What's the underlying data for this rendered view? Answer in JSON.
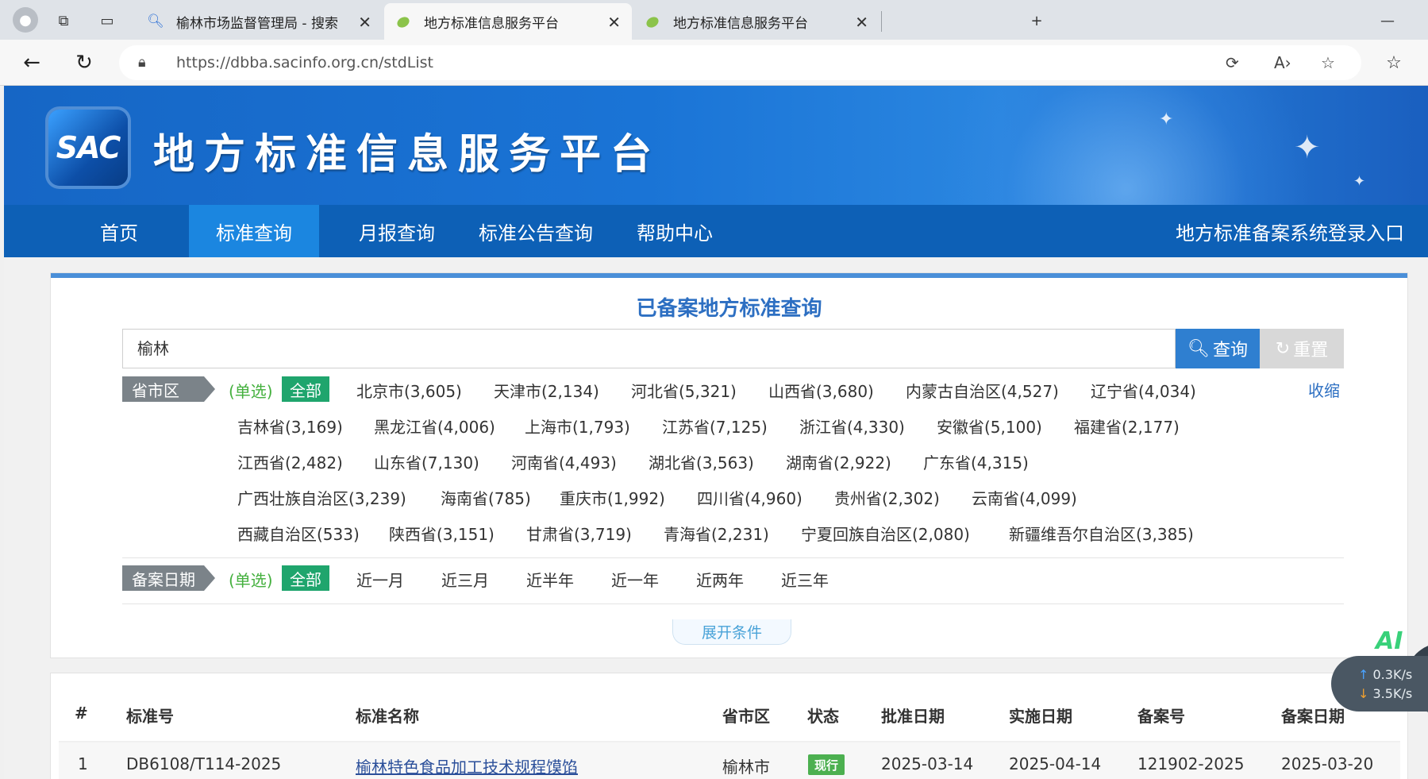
{
  "browser": {
    "tabs": [
      {
        "title": "榆林市场监督管理局 - 搜索",
        "favicon": "search-icon",
        "active": false
      },
      {
        "title": "地方标准信息服务平台",
        "favicon": "leaf-icon",
        "active": true
      },
      {
        "title": "地方标准信息服务平台",
        "favicon": "leaf-icon",
        "active": false
      }
    ],
    "new_tab_symbol": "+",
    "minimize_symbol": "—",
    "url": "https://dbba.sacinfo.org.cn/stdList"
  },
  "site": {
    "logo_text": "SAC",
    "title": "地方标准信息服务平台"
  },
  "nav": {
    "items": [
      {
        "label": "首页",
        "active": false
      },
      {
        "label": "标准查询",
        "active": true
      },
      {
        "label": "月报查询",
        "active": false
      },
      {
        "label": "标准公告查询",
        "active": false
      },
      {
        "label": "帮助中心",
        "active": false
      }
    ],
    "login_label": "地方标准备案系统登录入口"
  },
  "search": {
    "heading": "已备案地方标准查询",
    "query_value": "榆林",
    "query_button": "查询",
    "reset_button": "重置",
    "province_filter": {
      "label": "省市区",
      "mode_hint": "(单选)",
      "all_label": "全部",
      "collapse_label": "收缩",
      "options": [
        "北京市(3,605)",
        "天津市(2,134)",
        "河北省(5,321)",
        "山西省(3,680)",
        "内蒙古自治区(4,527)",
        "辽宁省(4,034)",
        "吉林省(3,169)",
        "黑龙江省(4,006)",
        "上海市(1,793)",
        "江苏省(7,125)",
        "浙江省(4,330)",
        "安徽省(5,100)",
        "福建省(2,177)",
        "江西省(2,482)",
        "山东省(7,130)",
        "河南省(4,493)",
        "湖北省(3,563)",
        "湖南省(2,922)",
        "广东省(4,315)",
        "广西壮族自治区(3,239)",
        "海南省(785)",
        "重庆市(1,992)",
        "四川省(4,960)",
        "贵州省(2,302)",
        "云南省(4,099)",
        "西藏自治区(533)",
        "陕西省(3,151)",
        "甘肃省(3,719)",
        "青海省(2,231)",
        "宁夏回族自治区(2,080)",
        "新疆维吾尔自治区(3,385)"
      ]
    },
    "date_filter": {
      "label": "备案日期",
      "mode_hint": "(单选)",
      "all_label": "全部",
      "options": [
        "近一月",
        "近三月",
        "近半年",
        "近一年",
        "近两年",
        "近三年"
      ]
    },
    "expand_label": "展开条件"
  },
  "table": {
    "headers": [
      "#",
      "标准号",
      "标准名称",
      "省市区",
      "状态",
      "批准日期",
      "实施日期",
      "备案号",
      "备案日期"
    ],
    "rows": [
      {
        "index": "1",
        "std_no": "DB6108/T114-2025",
        "name": "榆林特色食品加工技术规程馍馅",
        "region": "榆林市",
        "status": "现行",
        "approve_date": "2025-03-14",
        "effective_date": "2025-04-14",
        "record_no": "121902-2025",
        "record_date": "2025-03-20"
      }
    ]
  },
  "widgets": {
    "ai_label": "AI",
    "upload_speed": "0.3K/s",
    "download_speed": "3.5K/s"
  },
  "colors": {
    "banner": "#1a74d6",
    "nav": "#0d60b6",
    "nav_active": "#1b86e0",
    "accent": "#2f7fd0",
    "all_chip": "#1fa56d",
    "status_current": "#4cb050"
  }
}
